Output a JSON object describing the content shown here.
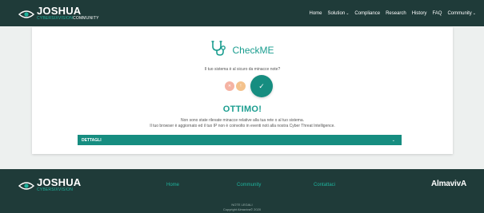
{
  "header": {
    "logo": {
      "main": "JOSHUA",
      "sub_green": "CYBERSIXVISION",
      "sub_white": "COMMUNITY"
    },
    "nav": [
      {
        "label": "Home",
        "dropdown": false
      },
      {
        "label": "Solution",
        "dropdown": true
      },
      {
        "label": "Compliance",
        "dropdown": false
      },
      {
        "label": "Research",
        "dropdown": false
      },
      {
        "label": "History",
        "dropdown": false
      },
      {
        "label": "FAQ",
        "dropdown": false
      },
      {
        "label": "Community",
        "dropdown": true
      }
    ]
  },
  "card": {
    "brand": "CheckME",
    "question": "Il tuo sistema è al sicuro da minacce note?",
    "indicators": {
      "red_label": "✕",
      "orange_label": "!",
      "green_label": "✓"
    },
    "result": "OTTIMO!",
    "message_line1": "Non sono state rilevate minacce relative alla tua rete o al tuo sistema.",
    "message_line2": "Il tuo browser è aggiornato ed il tuo IP non è coinvolto in eventi noti alla nostra Cyber Threat Intelligence.",
    "details_label": "DETTAGLI"
  },
  "footer": {
    "logo": {
      "main": "JOSHUA",
      "sub_green": "CYBERSIXVISION"
    },
    "links": [
      "Home",
      "Community",
      "Contattaci"
    ],
    "brand": "AlmavivA",
    "legal": "NOTE LEGALI",
    "copyright": "Copyright Almaviva© 2020"
  },
  "colors": {
    "header_bg": "#1f3b39",
    "accent": "#168d80",
    "accent_light": "#1fb39d"
  }
}
